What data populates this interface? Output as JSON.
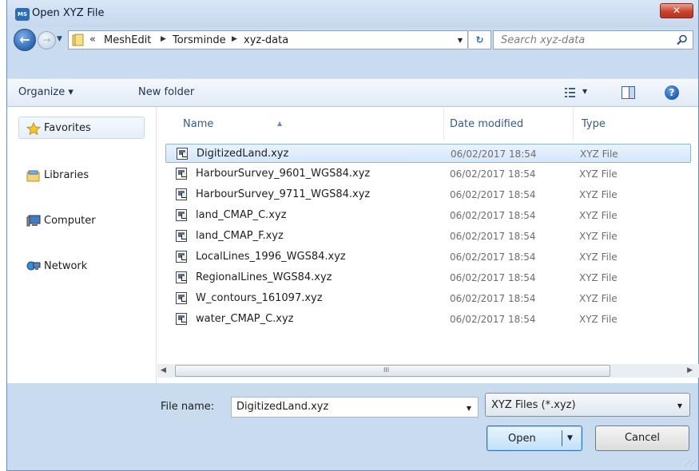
{
  "window": {
    "title": "Open XYZ File",
    "app_icon_text": "MS",
    "close_glyph": "✕"
  },
  "nav": {
    "back_glyph": "←",
    "forward_glyph": "→",
    "chevrons": "«",
    "breadcrumbs": [
      "MeshEdit",
      "Torsminde",
      "xyz-data"
    ],
    "refresh_glyph": "↻",
    "search_placeholder": "Search xyz-data"
  },
  "toolbar": {
    "organize_label": "Organize ▾",
    "new_folder_label": "New folder",
    "help_glyph": "?"
  },
  "sidebar": {
    "items": [
      {
        "label": "Favorites",
        "icon": "star-icon"
      },
      {
        "label": "Libraries",
        "icon": "libraries-icon"
      },
      {
        "label": "Computer",
        "icon": "computer-icon"
      },
      {
        "label": "Network",
        "icon": "network-icon"
      }
    ]
  },
  "columns": {
    "name": "Name",
    "date": "Date modified",
    "type": "Type"
  },
  "files": [
    {
      "name": "DigitizedLand.xyz",
      "date": "06/02/2017 18:54",
      "type": "XYZ File",
      "selected": true
    },
    {
      "name": "HarbourSurvey_9601_WGS84.xyz",
      "date": "06/02/2017 18:54",
      "type": "XYZ File"
    },
    {
      "name": "HarbourSurvey_9711_WGS84.xyz",
      "date": "06/02/2017 18:54",
      "type": "XYZ File"
    },
    {
      "name": "land_CMAP_C.xyz",
      "date": "06/02/2017 18:54",
      "type": "XYZ File"
    },
    {
      "name": "land_CMAP_F.xyz",
      "date": "06/02/2017 18:54",
      "type": "XYZ File"
    },
    {
      "name": "LocalLines_1996_WGS84.xyz",
      "date": "06/02/2017 18:54",
      "type": "XYZ File"
    },
    {
      "name": "RegionalLines_WGS84.xyz",
      "date": "06/02/2017 18:54",
      "type": "XYZ File"
    },
    {
      "name": "W_contours_161097.xyz",
      "date": "06/02/2017 18:54",
      "type": "XYZ File"
    },
    {
      "name": "water_CMAP_C.xyz",
      "date": "06/02/2017 18:54",
      "type": "XYZ File"
    }
  ],
  "scrollbar": {
    "grip": "III"
  },
  "bottom": {
    "file_name_label": "File name:",
    "file_name_value": "DigitizedLand.xyz",
    "filter_value": "XYZ Files (*.xyz)",
    "open_label": "Open",
    "cancel_label": "Cancel"
  }
}
